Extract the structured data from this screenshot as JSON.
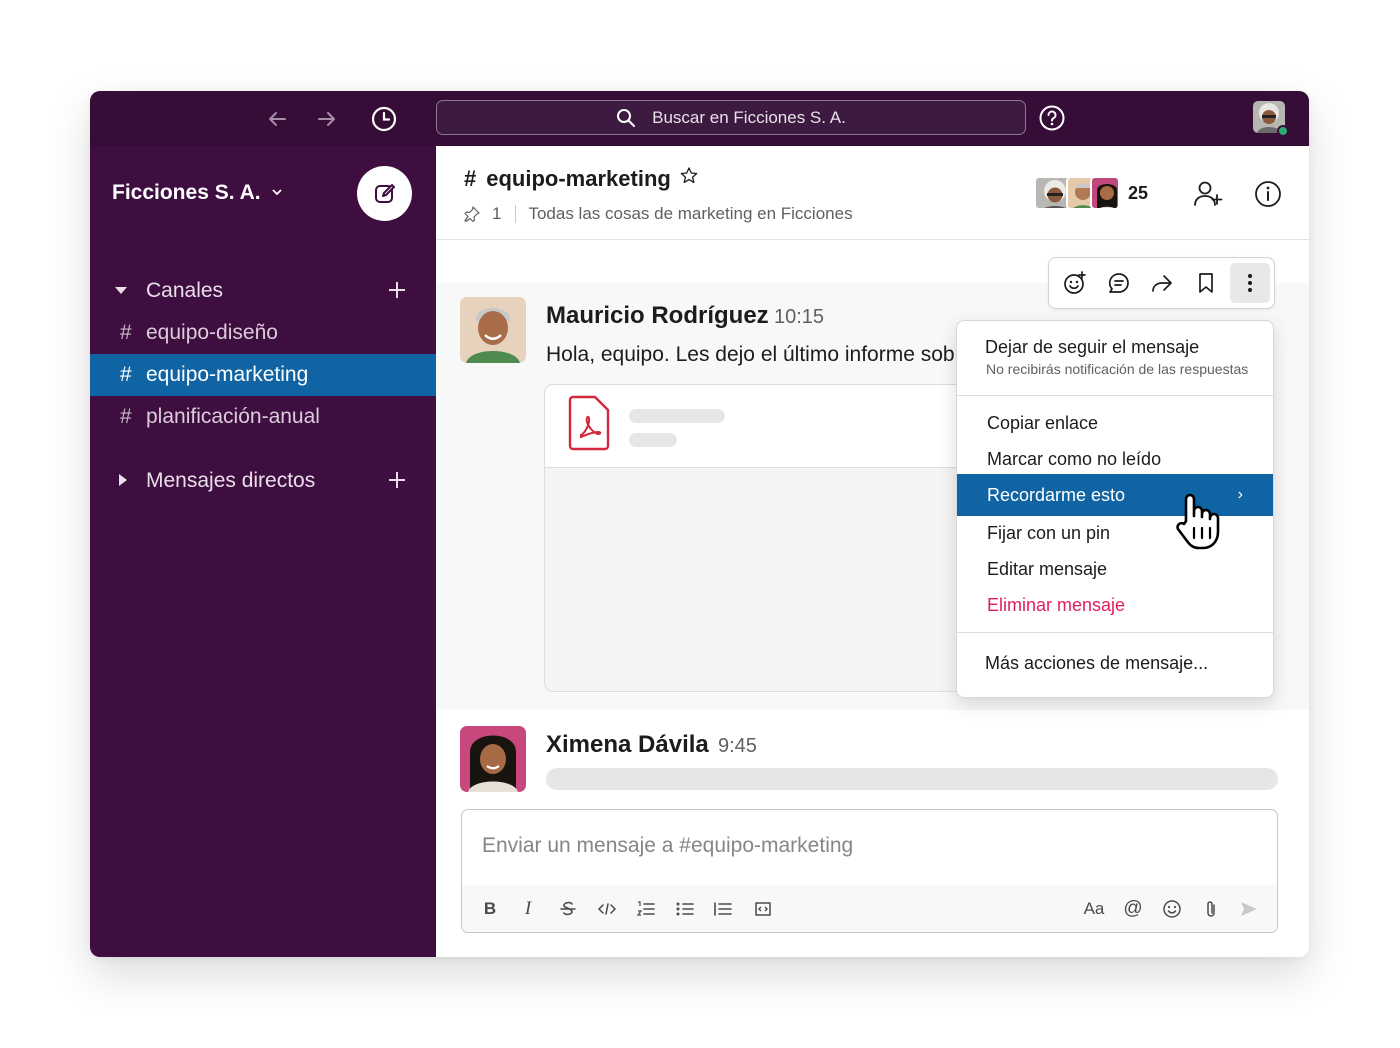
{
  "topbar": {
    "search_placeholder": "Buscar en Ficciones S. A."
  },
  "sidebar": {
    "workspace_name": "Ficciones S. A.",
    "channels_label": "Canales",
    "channels": [
      {
        "hash": "#",
        "name": "equipo-diseño"
      },
      {
        "hash": "#",
        "name": "equipo-marketing"
      },
      {
        "hash": "#",
        "name": "planificación-anual"
      }
    ],
    "dms_label": "Mensajes directos"
  },
  "channel": {
    "hash": "#",
    "name": "equipo-marketing",
    "pin_count": "1",
    "topic": "Todas las cosas de marketing en Ficciones",
    "member_count": "25"
  },
  "messages": [
    {
      "author": "Mauricio Rodríguez",
      "time": "10:15",
      "text": "Hola, equipo. Les dejo el último informe sob"
    },
    {
      "author": "Ximena Dávila",
      "time": "9:45"
    }
  ],
  "context_menu": {
    "unfollow_title": "Dejar de seguir el mensaje",
    "unfollow_sub": "No recibirás notificación de las respuestas",
    "copy_link": "Copiar enlace",
    "mark_unread": "Marcar como no leído",
    "remind_me": "Recordarme esto",
    "remind_arrow": "›",
    "pin": "Fijar con un pin",
    "edit": "Editar mensaje",
    "delete": "Eliminar mensaje",
    "more_actions": "Más acciones de mensaje..."
  },
  "composer": {
    "placeholder": "Enviar un mensaje a #equipo-marketing",
    "bold": "B",
    "italic": "I",
    "format_label": "Aa",
    "mention": "@"
  },
  "colors": {
    "topbar": "#350d36",
    "sidebar": "#3f0e40",
    "active_channel": "#1164a3",
    "danger": "#e01e5a",
    "presence": "#2bac76"
  }
}
